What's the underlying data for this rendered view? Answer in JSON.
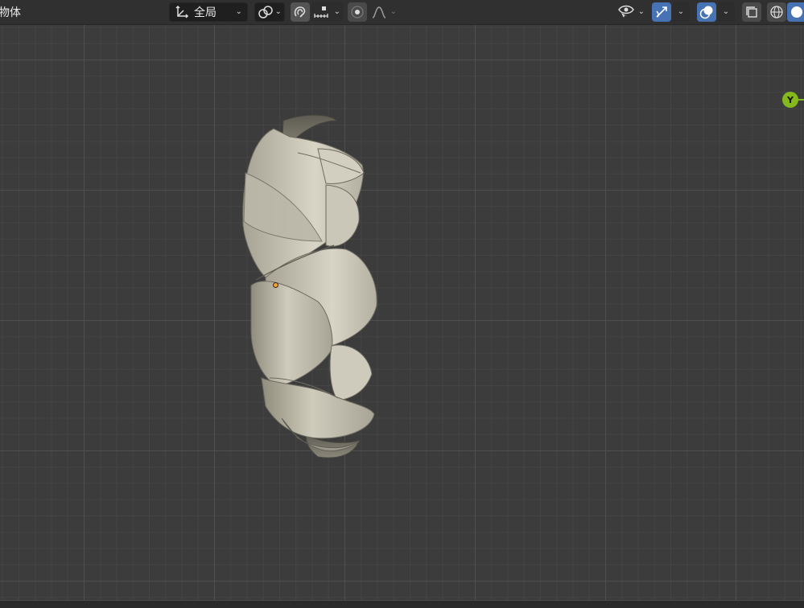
{
  "header": {
    "mode_label": "物体",
    "transform_orientation": {
      "icon": "transform-orientation-icon",
      "value": "全局"
    },
    "pivot_icon": "link-pivot-icon",
    "snap_icon": "snap-magnet-icon",
    "snap_target_icon": "snap-increment-icon",
    "proportional_edit_icon": "proportional-edit-icon",
    "falloff_icon": "falloff-curve-icon",
    "visibility_icon": "eye-visibility-icon",
    "gizmo_icon": "gizmo-arrows-icon",
    "overlay_icon": "overlay-circles-icon",
    "xray_icon": "xray-toggle-icon",
    "wireframe_icon": "wireframe-shading-icon",
    "solid_icon": "solid-shading-icon"
  },
  "viewport": {
    "axis_gizmo_label": "Y",
    "object_color": "#c9c6b6",
    "axis_y_color": "#84b81b",
    "active_toggle_color": "#4772b3"
  }
}
